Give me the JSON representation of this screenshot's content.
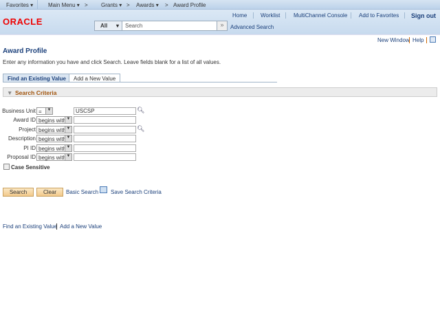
{
  "nav": {
    "items": [
      "Favorites ▾",
      "Main Menu ▾",
      ">",
      "Grants ▾",
      ">",
      "Awards ▾",
      ">",
      "Award Profile"
    ]
  },
  "header": {
    "logo": "ORACLE",
    "links": [
      "Home",
      "Worklist",
      "MultiChannel Console",
      "Add to Favorites"
    ],
    "signout": "Sign out",
    "search_scope": "All",
    "search_placeholder": "Search",
    "go": "»",
    "advanced": "Advanced Search"
  },
  "util": {
    "new_window": "New Window",
    "help": "Help"
  },
  "page": {
    "title": "Award Profile",
    "instructions": "Enter any information you have and click Search. Leave fields blank for a list of all values."
  },
  "tabs": [
    "Find an Existing Value",
    "Add a New Value"
  ],
  "criteria": {
    "title": "Search Criteria",
    "fields": [
      {
        "label": "Business Unit",
        "op": "=",
        "value": "USCSP",
        "lookup": true
      },
      {
        "label": "Award ID",
        "op": "begins with",
        "value": "",
        "lookup": false
      },
      {
        "label": "Project",
        "op": "begins with",
        "value": "",
        "lookup": true
      },
      {
        "label": "Description",
        "op": "begins with",
        "value": "",
        "lookup": false
      },
      {
        "label": "PI ID",
        "op": "begins with",
        "value": "",
        "lookup": false
      },
      {
        "label": "Proposal ID",
        "op": "begins with",
        "value": "",
        "lookup": false
      }
    ],
    "case_sensitive": "Case Sensitive"
  },
  "actions": {
    "search": "Search",
    "clear": "Clear",
    "basic": "Basic Search",
    "save": "Save Search Criteria"
  },
  "footer": {
    "find": "Find an Existing Value",
    "add": "Add a New Value"
  }
}
